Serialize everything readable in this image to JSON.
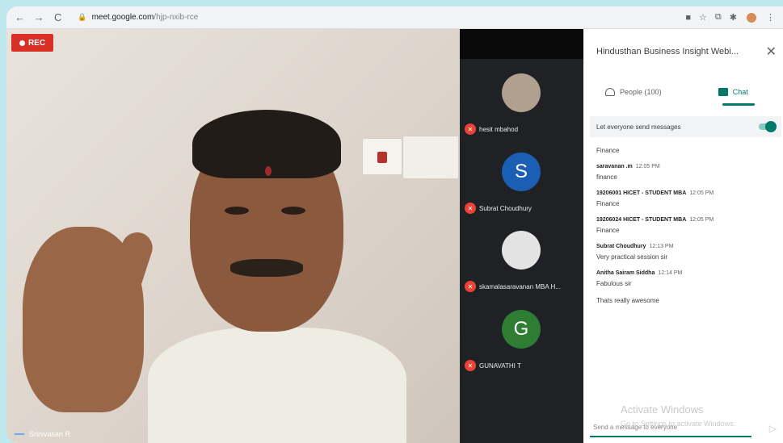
{
  "browser": {
    "url_host": "meet.google.com",
    "url_path": "/hjp-nxib-rce",
    "back": "←",
    "forward": "→",
    "reload": "C",
    "lock": "🔒",
    "right_icons": [
      "■",
      "☆",
      "⧉",
      "✱",
      "⋮"
    ]
  },
  "video": {
    "rec_label": "REC",
    "self_name": "Srinivasan R"
  },
  "participants": [
    {
      "name": "hesit mbahod",
      "initial": "",
      "avatar_color": "#b0a08f"
    },
    {
      "name": "Subrat Choudhury",
      "initial": "S",
      "avatar_color": "#1a5fb4"
    },
    {
      "name": "skamalasaravanan MBA H...",
      "initial": "",
      "avatar_color": "#e3e3e3"
    },
    {
      "name": "GUNAVATHI T",
      "initial": "G",
      "avatar_color": "#2e7d32"
    }
  ],
  "panel": {
    "title": "Hindusthan Business Insight Webi...",
    "close": "✕",
    "tab_people": "People (100)",
    "tab_chat": "Chat",
    "toggle_label": "Let everyone send messages",
    "messages": [
      {
        "sender": "",
        "time": "",
        "text": "Finance"
      },
      {
        "sender": "saravanan .m",
        "time": "12:05 PM",
        "text": "finance"
      },
      {
        "sender": "19206001 HICET - STUDENT MBA",
        "time": "12:05 PM",
        "text": "Finance"
      },
      {
        "sender": "19206024 HICET - STUDENT MBA",
        "time": "12:05 PM",
        "text": "Finance"
      },
      {
        "sender": "Subrat Choudhury",
        "time": "12:13 PM",
        "text": "Very practical session sir"
      },
      {
        "sender": "Anitha Sairam Siddha",
        "time": "12:14 PM",
        "text": "Fabulous sir"
      },
      {
        "sender": "",
        "time": "",
        "text": "Thats really awesome"
      }
    ],
    "watermark_title": "Activate Windows",
    "watermark_sub": "Go to Settings to activate Windows.",
    "input_placeholder": "Send a message to everyone",
    "send": "▷"
  }
}
